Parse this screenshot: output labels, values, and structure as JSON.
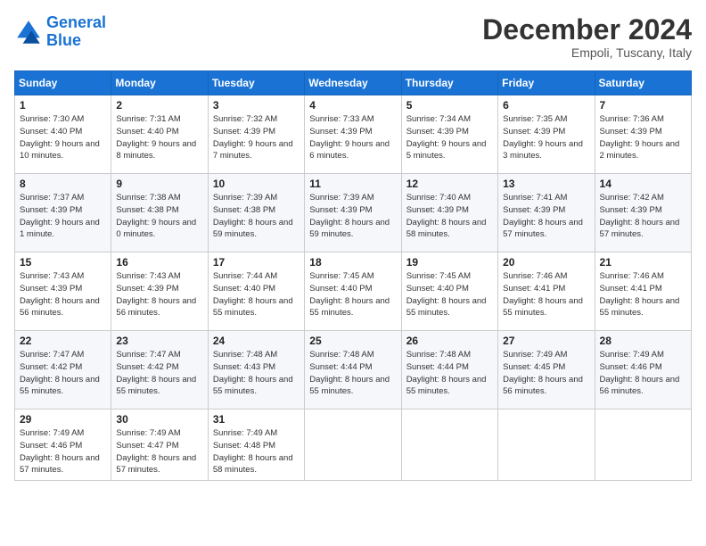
{
  "header": {
    "logo_line1": "General",
    "logo_line2": "Blue",
    "month": "December 2024",
    "location": "Empoli, Tuscany, Italy"
  },
  "weekdays": [
    "Sunday",
    "Monday",
    "Tuesday",
    "Wednesday",
    "Thursday",
    "Friday",
    "Saturday"
  ],
  "weeks": [
    [
      {
        "day": "1",
        "sunrise": "7:30 AM",
        "sunset": "4:40 PM",
        "daylight": "9 hours and 10 minutes."
      },
      {
        "day": "2",
        "sunrise": "7:31 AM",
        "sunset": "4:40 PM",
        "daylight": "9 hours and 8 minutes."
      },
      {
        "day": "3",
        "sunrise": "7:32 AM",
        "sunset": "4:39 PM",
        "daylight": "9 hours and 7 minutes."
      },
      {
        "day": "4",
        "sunrise": "7:33 AM",
        "sunset": "4:39 PM",
        "daylight": "9 hours and 6 minutes."
      },
      {
        "day": "5",
        "sunrise": "7:34 AM",
        "sunset": "4:39 PM",
        "daylight": "9 hours and 5 minutes."
      },
      {
        "day": "6",
        "sunrise": "7:35 AM",
        "sunset": "4:39 PM",
        "daylight": "9 hours and 3 minutes."
      },
      {
        "day": "7",
        "sunrise": "7:36 AM",
        "sunset": "4:39 PM",
        "daylight": "9 hours and 2 minutes."
      }
    ],
    [
      {
        "day": "8",
        "sunrise": "7:37 AM",
        "sunset": "4:39 PM",
        "daylight": "9 hours and 1 minute."
      },
      {
        "day": "9",
        "sunrise": "7:38 AM",
        "sunset": "4:38 PM",
        "daylight": "9 hours and 0 minutes."
      },
      {
        "day": "10",
        "sunrise": "7:39 AM",
        "sunset": "4:38 PM",
        "daylight": "8 hours and 59 minutes."
      },
      {
        "day": "11",
        "sunrise": "7:39 AM",
        "sunset": "4:39 PM",
        "daylight": "8 hours and 59 minutes."
      },
      {
        "day": "12",
        "sunrise": "7:40 AM",
        "sunset": "4:39 PM",
        "daylight": "8 hours and 58 minutes."
      },
      {
        "day": "13",
        "sunrise": "7:41 AM",
        "sunset": "4:39 PM",
        "daylight": "8 hours and 57 minutes."
      },
      {
        "day": "14",
        "sunrise": "7:42 AM",
        "sunset": "4:39 PM",
        "daylight": "8 hours and 57 minutes."
      }
    ],
    [
      {
        "day": "15",
        "sunrise": "7:43 AM",
        "sunset": "4:39 PM",
        "daylight": "8 hours and 56 minutes."
      },
      {
        "day": "16",
        "sunrise": "7:43 AM",
        "sunset": "4:39 PM",
        "daylight": "8 hours and 56 minutes."
      },
      {
        "day": "17",
        "sunrise": "7:44 AM",
        "sunset": "4:40 PM",
        "daylight": "8 hours and 55 minutes."
      },
      {
        "day": "18",
        "sunrise": "7:45 AM",
        "sunset": "4:40 PM",
        "daylight": "8 hours and 55 minutes."
      },
      {
        "day": "19",
        "sunrise": "7:45 AM",
        "sunset": "4:40 PM",
        "daylight": "8 hours and 55 minutes."
      },
      {
        "day": "20",
        "sunrise": "7:46 AM",
        "sunset": "4:41 PM",
        "daylight": "8 hours and 55 minutes."
      },
      {
        "day": "21",
        "sunrise": "7:46 AM",
        "sunset": "4:41 PM",
        "daylight": "8 hours and 55 minutes."
      }
    ],
    [
      {
        "day": "22",
        "sunrise": "7:47 AM",
        "sunset": "4:42 PM",
        "daylight": "8 hours and 55 minutes."
      },
      {
        "day": "23",
        "sunrise": "7:47 AM",
        "sunset": "4:42 PM",
        "daylight": "8 hours and 55 minutes."
      },
      {
        "day": "24",
        "sunrise": "7:48 AM",
        "sunset": "4:43 PM",
        "daylight": "8 hours and 55 minutes."
      },
      {
        "day": "25",
        "sunrise": "7:48 AM",
        "sunset": "4:44 PM",
        "daylight": "8 hours and 55 minutes."
      },
      {
        "day": "26",
        "sunrise": "7:48 AM",
        "sunset": "4:44 PM",
        "daylight": "8 hours and 55 minutes."
      },
      {
        "day": "27",
        "sunrise": "7:49 AM",
        "sunset": "4:45 PM",
        "daylight": "8 hours and 56 minutes."
      },
      {
        "day": "28",
        "sunrise": "7:49 AM",
        "sunset": "4:46 PM",
        "daylight": "8 hours and 56 minutes."
      }
    ],
    [
      {
        "day": "29",
        "sunrise": "7:49 AM",
        "sunset": "4:46 PM",
        "daylight": "8 hours and 57 minutes."
      },
      {
        "day": "30",
        "sunrise": "7:49 AM",
        "sunset": "4:47 PM",
        "daylight": "8 hours and 57 minutes."
      },
      {
        "day": "31",
        "sunrise": "7:49 AM",
        "sunset": "4:48 PM",
        "daylight": "8 hours and 58 minutes."
      },
      null,
      null,
      null,
      null
    ]
  ]
}
